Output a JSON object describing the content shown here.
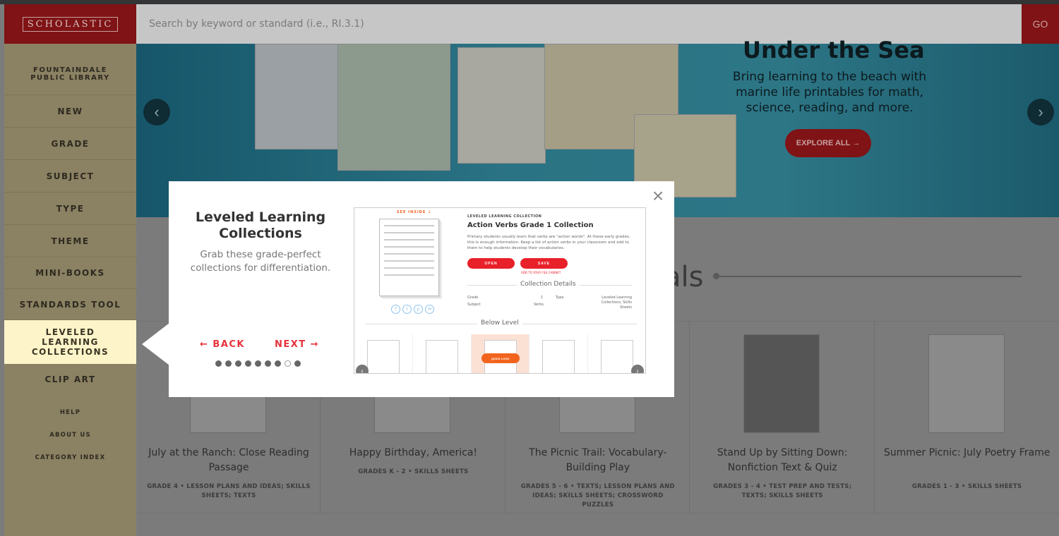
{
  "header": {
    "logo": "SCHOLASTIC",
    "search_placeholder": "Search by keyword or standard (i.e., RI.3.1)",
    "go_label": "GO"
  },
  "sidebar": {
    "library": "FOUNTAINDALE PUBLIC LIBRARY",
    "items": [
      "NEW",
      "GRADE",
      "SUBJECT",
      "TYPE",
      "THEME",
      "MINI-BOOKS",
      "STANDARDS TOOL",
      "LEVELED LEARNING COLLECTIONS",
      "CLIP ART"
    ],
    "active": "LEVELED LEARNING COLLECTIONS",
    "links": [
      "HELP",
      "ABOUT US",
      "CATEGORY INDEX"
    ]
  },
  "banner": {
    "title": "Under the Sea",
    "subtitle": "Bring learning to the beach with marine life printables for math, science, reading, and more.",
    "cta": "EXPLORE ALL →"
  },
  "section": {
    "heading_partial": "als"
  },
  "cards": [
    {
      "title": "July at the Ranch: Close Reading Passage",
      "meta": "GRADE 4 • LESSON PLANS AND IDEAS; SKILLS SHEETS; TEXTS"
    },
    {
      "title": "Happy Birthday, America!",
      "meta": "GRADES K - 2 • SKILLS SHEETS"
    },
    {
      "title": "The Picnic Trail: Vocabulary-Building Play",
      "meta": "GRADES 5 - 6 • TEXTS; LESSON PLANS AND IDEAS; SKILLS SHEETS; CROSSWORD PUZZLES"
    },
    {
      "title": "Stand Up by Sitting Down: Nonfiction Text & Quiz",
      "meta": "GRADES 3 - 4 • TEST PREP AND TESTS; TEXTS; SKILLS SHEETS"
    },
    {
      "title": "Summer Picnic: July Poetry Frame",
      "meta": "GRADES 1 - 3 • SKILLS SHEETS"
    }
  ],
  "tour": {
    "title": "Leveled Learning Collections",
    "description": "Grab these grade-perfect collections for differentiation.",
    "back": "← BACK",
    "next": "NEXT →",
    "step": 8,
    "total_steps": 9,
    "close": "×",
    "preview": {
      "see_inside": "SEE INSIDE ↓",
      "kicker": "LEVELED LEARNING COLLECTION",
      "title": "Action Verbs Grade 1 Collection",
      "description": "Primary students usually learn that verbs are \"action words\". At these early grades, this is enough information. Keep a list of action verbs in your classroom and add to them to help students develop their vocabularies.",
      "open": "OPEN",
      "save": "SAVE",
      "add_cabinet": "ADD TO YOUR FILE CABINET",
      "details_heading": "Collection Details",
      "grade_label": "Grade",
      "grade": "1",
      "subject_label": "Subject",
      "subject": "Verbs",
      "type_label": "Type",
      "type": "Leveled Learning Collections, Skills Sheets",
      "below_level": "Below Level",
      "quick_look": "QUICK LOOK",
      "social": [
        "f",
        "t",
        "p",
        "✉"
      ]
    }
  },
  "colors": {
    "brand_red": "#e8202a",
    "active_nav": "#fdf4c9",
    "accent_orange": "#f2641e"
  }
}
